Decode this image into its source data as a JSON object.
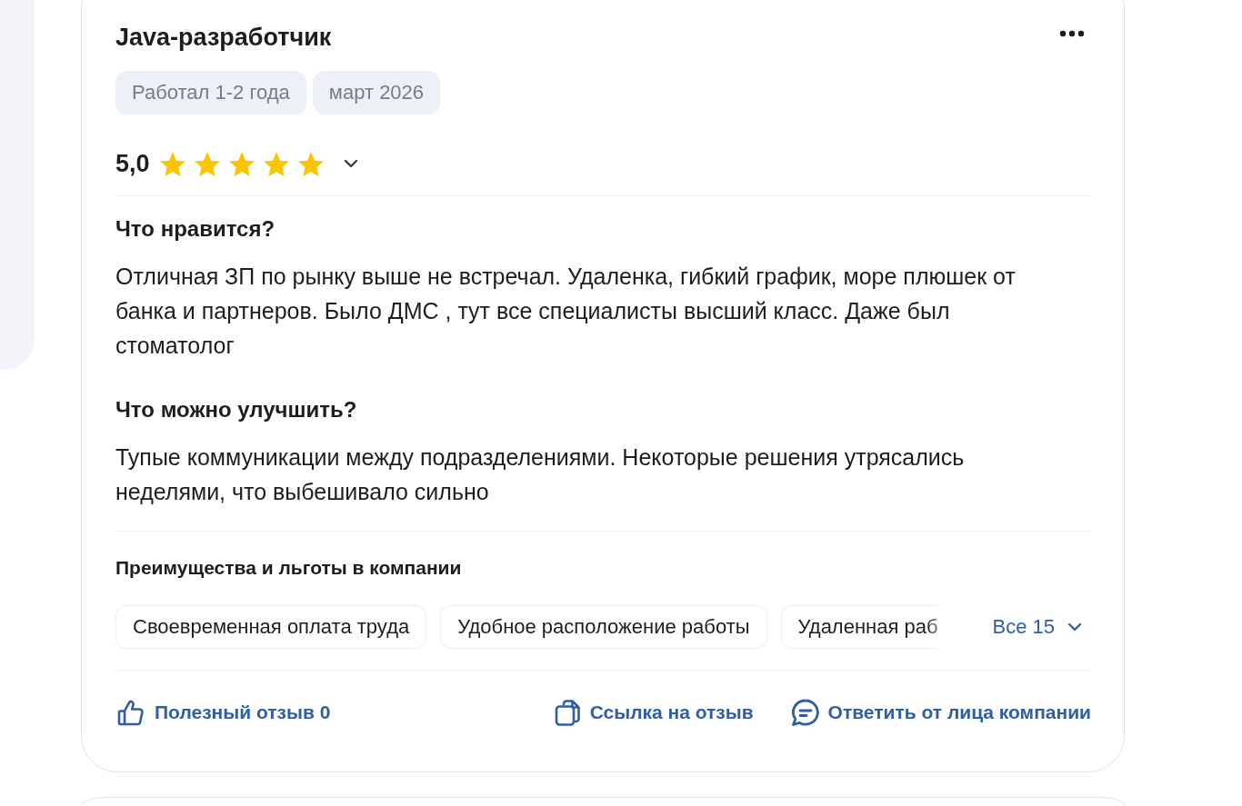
{
  "review": {
    "title": "Java-разработчик",
    "tags": [
      "Работал 1-2 года",
      "март 2026"
    ],
    "rating": {
      "value": "5,0",
      "stars": 5,
      "expanded": false
    },
    "sections": [
      {
        "heading": "Что нравится?",
        "text": "Отличная ЗП по рынку выше не встречал. Удаленка, гибкий график, море плюшек от банка и партнеров. Было ДМС , тут все специалисты высший класс. Даже был стоматолог"
      },
      {
        "heading": "Что можно улучшить?",
        "text": "Тупые коммуникации между подразделениями. Некоторые решения утрясались неделями, что выбешивало сильно"
      }
    ],
    "benefits": {
      "heading": "Преимущества и льготы в компании",
      "items": [
        "Своевременная оплата труда",
        "Удобное расположение работы",
        "Удаленная раб"
      ],
      "show_all": "Все 15",
      "expanded": false
    },
    "actions": [
      {
        "kind": "like",
        "label": "Полезный отзыв 0"
      },
      {
        "kind": "link",
        "label": "Ссылка на отзыв"
      },
      {
        "kind": "reply",
        "label": "Ответить от лица компании"
      }
    ]
  }
}
